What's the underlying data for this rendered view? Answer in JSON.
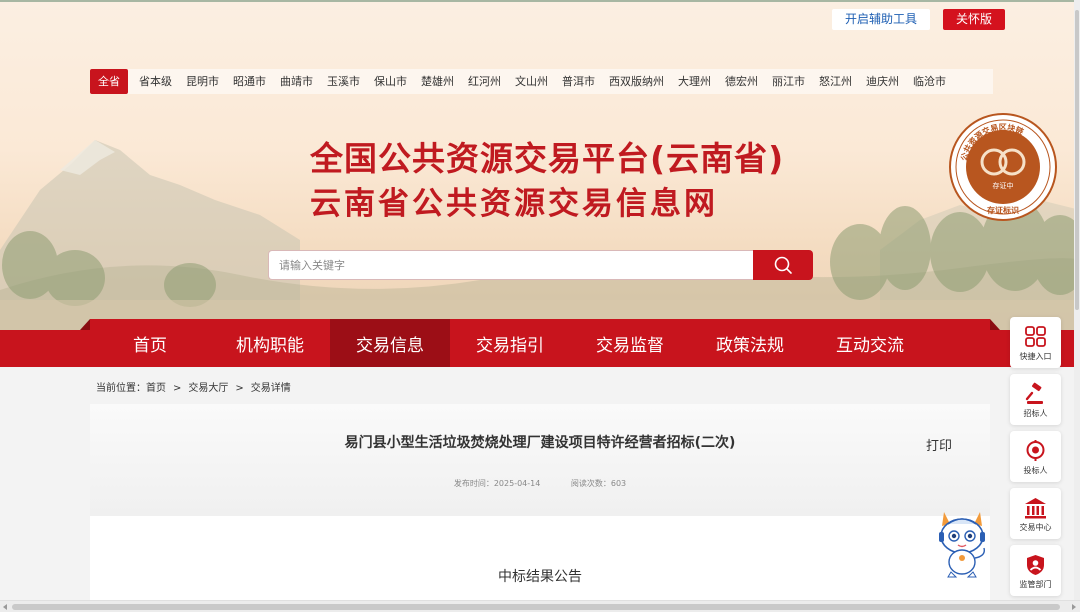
{
  "toolbar": {
    "assist_label": "开启辅助工具",
    "care_label": "关怀版"
  },
  "cities": {
    "active": "全省",
    "items": [
      "省本级",
      "昆明市",
      "昭通市",
      "曲靖市",
      "玉溪市",
      "保山市",
      "楚雄州",
      "红河州",
      "文山州",
      "普洱市",
      "西双版纳州",
      "大理州",
      "德宏州",
      "丽江市",
      "怒江州",
      "迪庆州",
      "临沧市"
    ]
  },
  "header": {
    "title_line1": "全国公共资源交易平台(云南省)",
    "title_line2": "云南省公共资源交易信息网"
  },
  "seal": {
    "ring_text": "公共资源交易区块链",
    "center_text": "存证中",
    "bottom_text": "存证标识",
    "icon": "blockchain-seal-icon"
  },
  "search": {
    "placeholder": "请输入关键字",
    "value": "",
    "icon": "search-icon"
  },
  "nav": {
    "items": [
      "首页",
      "机构职能",
      "交易信息",
      "交易指引",
      "交易监督",
      "政策法规",
      "互动交流"
    ],
    "active": "交易信息"
  },
  "breadcrumb": {
    "prefix": "当前位置：",
    "items": [
      "首页",
      "交易大厅",
      "交易详情"
    ],
    "separator": ">"
  },
  "article": {
    "title": "易门县小型生活垃圾焚烧处理厂建设项目特许经营者招标(二次)",
    "print_label": "打印",
    "publish_label": "发布时间：",
    "publish_date": "2025-04-14",
    "views_label": "阅读次数：",
    "views": "603",
    "notice_title": "中标结果公告"
  },
  "sidebar": {
    "items": [
      {
        "label": "快捷入口",
        "icon": "grid-icon"
      },
      {
        "label": "招标人",
        "icon": "gavel-icon"
      },
      {
        "label": "投标人",
        "icon": "location-pin-icon"
      },
      {
        "label": "交易中心",
        "icon": "building-icon"
      },
      {
        "label": "监管部门",
        "icon": "shield-icon"
      }
    ]
  },
  "colors": {
    "brand_red": "#c8141d",
    "nav_active": "#9c0e16",
    "title_red": "#c01a20",
    "link_blue": "#1e5fb3"
  }
}
